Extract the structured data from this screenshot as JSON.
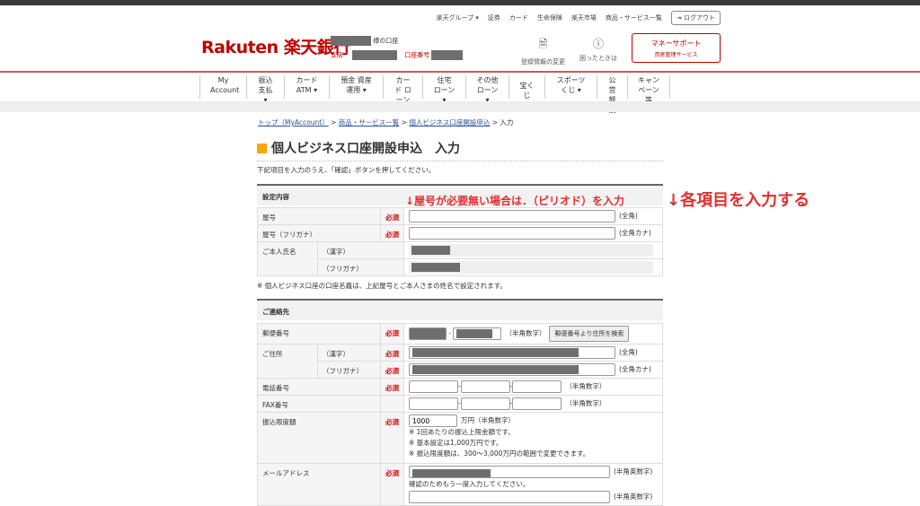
{
  "header": {
    "util_links": [
      "楽天グループ ▾",
      "証券",
      "カード",
      "生命保険",
      "楽天市場",
      "商品・サービス一覧"
    ],
    "logout": "ログアウト",
    "logo": "Rakuten 楽天銀行",
    "account_suffix": "様の口座",
    "branch_label": "支店",
    "account_no_label": "口座番号",
    "profile_change": "登録情報の変更",
    "help": "困ったときは",
    "money_support": "マネーサポート",
    "money_support_sub": "資産管理サービス"
  },
  "nav": [
    "My Account",
    "振込 支払 ▾",
    "カード ATM ▾",
    "預金 資産運用 ▾",
    "カード ローン",
    "住宅 ローン ▾",
    "その他 ローン ▾",
    "宝くじ",
    "スポーツ くじ ▾",
    "公営 競技",
    "キャン ペーン等"
  ],
  "breadcrumb": {
    "items": [
      "トップ（MyAccount）",
      "商品・サービス一覧",
      "個人ビジネス口座開設申込"
    ],
    "current": "入力",
    "sep": " > "
  },
  "page": {
    "title": "個人ビジネス口座開設申込　入力",
    "lead": "下記項目を入力のうえ、「確認」ボタンを押してください。",
    "note": "※ 個人ビジネス口座の口座名義は、上記屋号とご本人さまの姓名で設定されます。"
  },
  "annotations": {
    "a1": "↓屋号が必要無い場合は．（ピリオド）を入力",
    "a2": "↓各項目を入力する"
  },
  "required": "必須",
  "section1": {
    "title": "設定内容",
    "yago": "屋号",
    "yago_kana": "屋号（フリガナ）",
    "name": "ご本人氏名",
    "kanji": "（漢字）",
    "furigana": "（フリガナ）",
    "hint_zen": "(全角)",
    "hint_kana": "(全角カナ)"
  },
  "section2": {
    "title": "ご連絡先",
    "postal": "郵便番号",
    "postal_hint": "（半角数字）",
    "postal_btn": "郵便番号より住所を検索",
    "address": "ご住所",
    "kanji": "（漢字）",
    "furigana": "（フリガナ）",
    "hint_zen": "(全角)",
    "hint_kana": "(全角カナ)",
    "phone": "電話番号",
    "fax": "FAX番号",
    "num_hint": "（半角数字）",
    "limit": "振込限度額",
    "limit_value": "1000",
    "limit_unit": "万円（半角数字）",
    "limit_notes": [
      "※ 1回あたりの振込上限金額です。",
      "※ 基本設定は1,000万円です。",
      "※ 振込限度額は、300〜3,000万円の範囲で変更できます。"
    ],
    "email": "メールアドレス",
    "email_hint": "(半角英数字)",
    "email_confirm": "確認のためもう一度入力してください。"
  }
}
